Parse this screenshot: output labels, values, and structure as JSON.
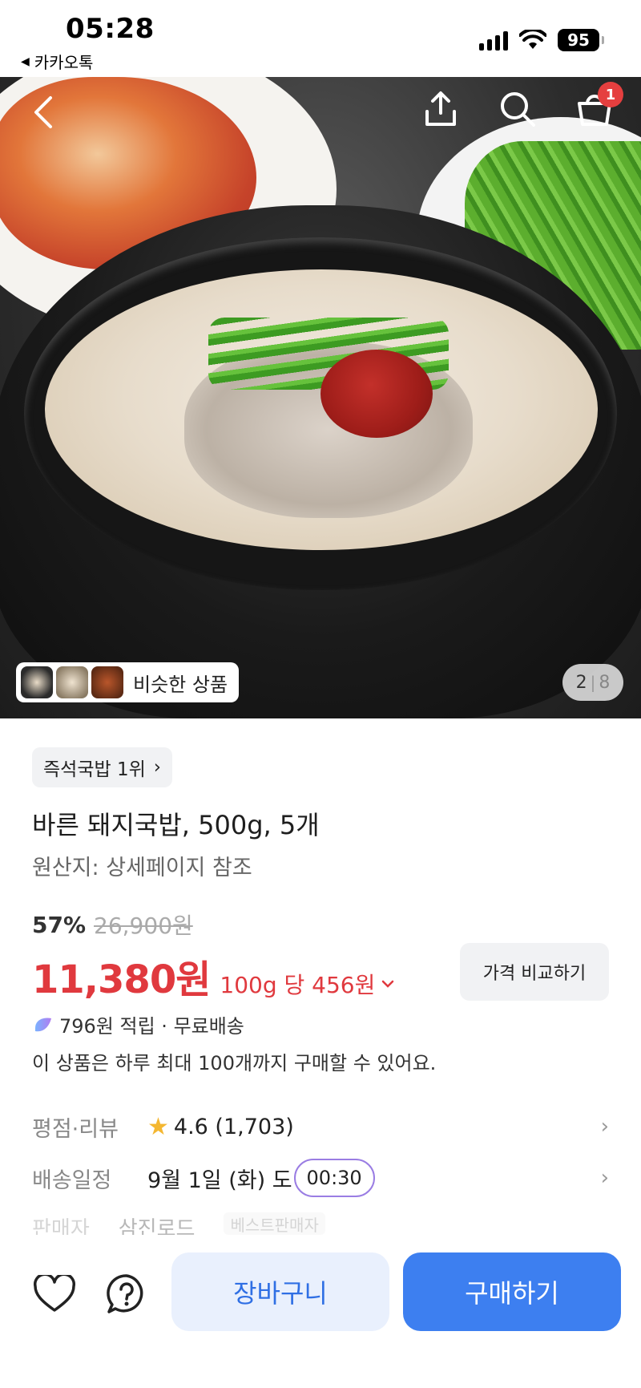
{
  "status_bar": {
    "time": "05:28",
    "back_app": "카카오톡",
    "battery": "95"
  },
  "hero": {
    "similar_label": "비슷한 상품",
    "page_current": "2",
    "page_total": "8",
    "cart_count": "1",
    "icons": [
      "back-arrow-icon",
      "share-icon",
      "search-icon",
      "cart-icon"
    ]
  },
  "product": {
    "rank_badge": "즉석국밥 1위",
    "title": "바른 돼지국밥, 500g, 5개",
    "origin": "원산지: 상세페이지 참조",
    "discount": "57%",
    "original_price": "26,900원",
    "price": "11,380원",
    "unit_price": "100g 당 456원",
    "compare_label": "가격 비교하기",
    "points": "796원 적립 · 무료배송",
    "purchase_limit": "이 상품은 하루 최대 100개까지 구매할 수 있어요."
  },
  "details": {
    "rating_label": "평점·리뷰",
    "rating_value": "4.6 (1,703)",
    "delivery_label": "배송일정",
    "delivery_value": "9월 1일 (화) 도",
    "delivery_timer": "00:30",
    "seller_label": "판매자",
    "seller_value": "삼진로드",
    "seller_badge": "베스트판매자"
  },
  "bottom_bar": {
    "cart_label": "장바구니",
    "buy_label": "구매하기"
  },
  "colors": {
    "price_red": "#e0393e",
    "primary_blue": "#3d7ff0",
    "cart_blue_bg": "#e9f0fd",
    "chip_gray": "#f1f2f4"
  }
}
